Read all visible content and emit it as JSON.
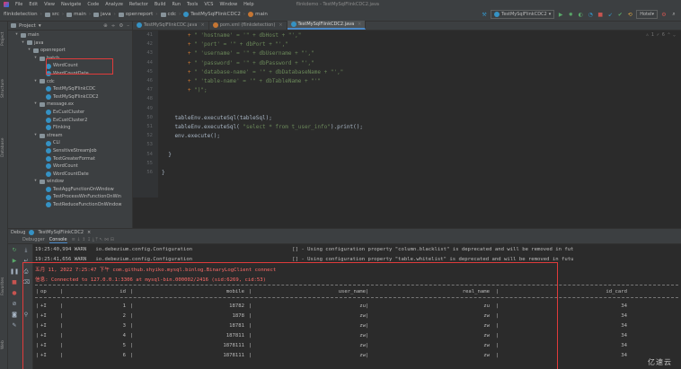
{
  "menubar": {
    "items": [
      "File",
      "Edit",
      "View",
      "Navigate",
      "Code",
      "Analyze",
      "Refactor",
      "Build",
      "Run",
      "Tools",
      "VCS",
      "Window",
      "Help"
    ],
    "window_title": "flinkdemo - TestMySqlFlinkCDC2.java"
  },
  "navbar": {
    "breadcrumbs": [
      "flinkdetection",
      "src",
      "main",
      "java",
      "openreport",
      "cdc",
      "TestMySqlFlinkCDC2",
      "main"
    ],
    "run_config": "TestMySqlFlinkCDC2",
    "git_label": "Hotel"
  },
  "project": {
    "title": "Project",
    "tree": [
      {
        "label": "main",
        "indent": 1,
        "kind": "folder",
        "open": true
      },
      {
        "label": "java",
        "indent": 2,
        "kind": "folder",
        "open": true
      },
      {
        "label": "openreport",
        "indent": 3,
        "kind": "folder",
        "open": true
      },
      {
        "label": "batch",
        "indent": 4,
        "kind": "folder",
        "open": true
      },
      {
        "label": "WordCount",
        "indent": 5,
        "kind": "class"
      },
      {
        "label": "WordCountDate",
        "indent": 5,
        "kind": "class"
      },
      {
        "label": "cdc",
        "indent": 4,
        "kind": "folder",
        "open": true
      },
      {
        "label": "TestMySqlFlinkCDC",
        "indent": 5,
        "kind": "class"
      },
      {
        "label": "TestMySqlFlinkCDC2",
        "indent": 5,
        "kind": "class"
      },
      {
        "label": "message.ex",
        "indent": 4,
        "kind": "folder",
        "open": true
      },
      {
        "label": "ExCustCluster",
        "indent": 5,
        "kind": "class"
      },
      {
        "label": "ExCustCluster2",
        "indent": 5,
        "kind": "class"
      },
      {
        "label": "Flinking",
        "indent": 5,
        "kind": "class"
      },
      {
        "label": "stream",
        "indent": 4,
        "kind": "folder",
        "open": true
      },
      {
        "label": "CLI",
        "indent": 5,
        "kind": "class"
      },
      {
        "label": "SensitiveStreamJob",
        "indent": 5,
        "kind": "class"
      },
      {
        "label": "TextGreaterFormat",
        "indent": 5,
        "kind": "class"
      },
      {
        "label": "WordCount",
        "indent": 5,
        "kind": "class"
      },
      {
        "label": "WordCountDate",
        "indent": 5,
        "kind": "class"
      },
      {
        "label": "window",
        "indent": 4,
        "kind": "folder",
        "open": true
      },
      {
        "label": "TestAggFunctionOnWindow",
        "indent": 5,
        "kind": "class"
      },
      {
        "label": "TestProcessWinFunctionOnWin",
        "indent": 5,
        "kind": "class"
      },
      {
        "label": "TestReduceFunctionOnWindow",
        "indent": 5,
        "kind": "class"
      }
    ]
  },
  "tabs": [
    {
      "label": "TestMySqlFlinkCDC.java",
      "active": false
    },
    {
      "label": "pom.xml (flinkdetection)",
      "active": false
    },
    {
      "label": "TestMySqlFlinkCDC2.java",
      "active": true
    }
  ],
  "editor": {
    "line_numbers": [
      "41",
      "42",
      "43",
      "44",
      "45",
      "46",
      "47",
      "48",
      "49",
      "50",
      "51",
      "52",
      "53",
      "54",
      "55",
      "56"
    ],
    "lines": [
      [
        {
          "t": "        + ",
          "c": "op"
        },
        {
          "t": "\" 'hostname' = '\" + dbHost + \"',\"",
          "c": "str"
        }
      ],
      [
        {
          "t": "        + ",
          "c": "op"
        },
        {
          "t": "\" 'port' = '\" + dbPort + \"',\"",
          "c": "str"
        }
      ],
      [
        {
          "t": "        + ",
          "c": "op"
        },
        {
          "t": "\" 'username' = '\" + dbUsername + \"',\"",
          "c": "str"
        }
      ],
      [
        {
          "t": "        + ",
          "c": "op"
        },
        {
          "t": "\" 'password' = '\" + dbPassword + \"',\"",
          "c": "str"
        }
      ],
      [
        {
          "t": "        + ",
          "c": "op"
        },
        {
          "t": "\" 'database-name' = '\" + dbDatabaseName + \"',\"",
          "c": "str"
        }
      ],
      [
        {
          "t": "        + ",
          "c": "op"
        },
        {
          "t": "\" 'table-name' = '\" + dbTableName + \"'\"",
          "c": "str"
        }
      ],
      [
        {
          "t": "        + ",
          "c": "op"
        },
        {
          "t": "\")\";",
          "c": "str"
        }
      ],
      [
        {
          "t": "",
          "c": "plain"
        }
      ],
      [
        {
          "t": "",
          "c": "plain"
        }
      ],
      [
        {
          "t": "    tableEnv.executeSql(tableSql);",
          "c": "plain"
        }
      ],
      [
        {
          "t": "    tableEnv.executeSql( ",
          "c": "plain"
        },
        {
          "t": "\"select * from t_user_info\"",
          "c": "str"
        },
        {
          "t": ").print();",
          "c": "plain"
        }
      ],
      [
        {
          "t": "    env.execute();",
          "c": "plain"
        }
      ],
      [
        {
          "t": "",
          "c": "plain"
        }
      ],
      [
        {
          "t": "  }",
          "c": "plain"
        }
      ],
      [
        {
          "t": "",
          "c": "plain"
        }
      ],
      [
        {
          "t": "}",
          "c": "plain"
        }
      ]
    ]
  },
  "debug": {
    "title": "Debug",
    "config": "TestMySqlFlinkCDC2",
    "tabs": [
      "Debugger",
      "Console"
    ]
  },
  "console": {
    "lines": [
      {
        "text": "19:25:40,994 WARN   io.debezium.config.Configuration                                 [] - Using configuration property \"column.blacklist\" is deprecated and will be removed in fut",
        "cls": "warn"
      },
      {
        "text": "19:25:41,656 WARN   io.debezium.config.Configuration                                 [] - Using configuration property \"table.whitelist\" is deprecated and will be removed in futu",
        "cls": "warn"
      },
      {
        "text": "五月 11, 2022 7:25:47 下午 com.github.shyiko.mysql.binlog.BinaryLogClient connect",
        "cls": "err"
      },
      {
        "text": "信息: Connected to 127.0.0.1:3306 at mysql-bin.000002/2416 (sid:6269, cid:53)",
        "cls": "err"
      }
    ],
    "result_table": {
      "headers": [
        "op",
        "id",
        "mobile",
        "user_name",
        "real_name",
        "id_card"
      ],
      "rows": [
        [
          "+I",
          "1",
          "18782",
          "zu",
          "zu",
          "34"
        ],
        [
          "+I",
          "2",
          "1878",
          "zw",
          "zw",
          "34"
        ],
        [
          "+I",
          "3",
          "18781",
          "zw",
          "zw",
          "34"
        ],
        [
          "+I",
          "4",
          "187811",
          "zw",
          "zw",
          "34"
        ],
        [
          "+I",
          "5",
          "1878111",
          "zw",
          "zw",
          "34"
        ],
        [
          "+I",
          "6",
          "1878111",
          "zw",
          "zw",
          "34"
        ]
      ]
    }
  },
  "watermark": "亿速云"
}
